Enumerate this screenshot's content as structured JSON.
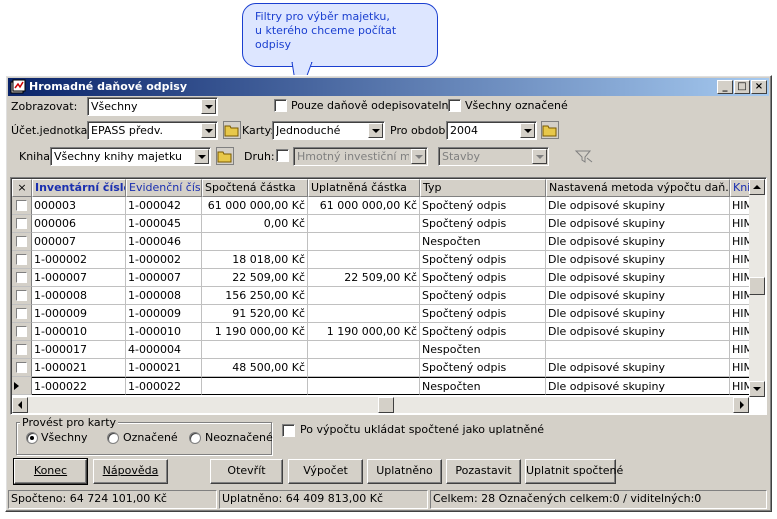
{
  "callout": {
    "text": "Filtry  pro výběr majetku,\nu kterého chceme počítat\nodpisy"
  },
  "window": {
    "title": "Hromadné daňové odpisy",
    "minimize": "_",
    "maximize": "□",
    "close": "×"
  },
  "filters": {
    "zobrazovat_label": "Zobrazovat:",
    "zobrazovat_value": "Všechny",
    "pouze_danove_label": "Pouze daňově odepisovatelné",
    "vsechny_oznacene_label": "Všechny označené",
    "ucet_jednotka_label": "Účet.jednotka:",
    "ucet_jednotka_value": "EPASS předv.",
    "karty_label": "Karty:",
    "karty_value": "Jednoduché",
    "pro_obdobi_label": "Pro období:",
    "pro_obdobi_value": "2004",
    "kniha_label": "Kniha:",
    "kniha_value": "Všechny knihy majetku",
    "druh_label": "Druh:",
    "druh_value": "Hmotný investiční majetek",
    "stavby_value": "Stavby"
  },
  "grid": {
    "columns": [
      "×",
      "Inventární číslo",
      "Evidenční číslo",
      "Spočtená částka",
      "Uplatněná částka",
      "Typ",
      "Nastavená metoda výpočtu daň. odp.",
      "Kniha"
    ],
    "rows": [
      {
        "checked": false,
        "inv": "000003",
        "evid": "1-000042",
        "spoctena": "61 000 000,00 Kč",
        "uplatnena": "61 000 000,00 Kč",
        "typ": "Spočtený odpis",
        "metoda": "Dle odpisové skupiny",
        "kniha": "HIM"
      },
      {
        "checked": false,
        "inv": "000006",
        "evid": "1-000045",
        "spoctena": "0,00 Kč",
        "uplatnena": "",
        "typ": "Spočtený odpis",
        "metoda": "Dle odpisové skupiny",
        "kniha": "HIM"
      },
      {
        "checked": false,
        "inv": "000007",
        "evid": "1-000046",
        "spoctena": "",
        "uplatnena": "",
        "typ": "Nespočten",
        "metoda": "Dle odpisové skupiny",
        "kniha": "HIM"
      },
      {
        "checked": false,
        "inv": "1-000002",
        "evid": "1-000002",
        "spoctena": "18 018,00 Kč",
        "uplatnena": "",
        "typ": "Spočtený odpis",
        "metoda": "Dle odpisové skupiny",
        "kniha": "HIM"
      },
      {
        "checked": false,
        "inv": "1-000007",
        "evid": "1-000007",
        "spoctena": "22 509,00 Kč",
        "uplatnena": "22 509,00 Kč",
        "typ": "Spočtený odpis",
        "metoda": "Dle odpisové skupiny",
        "kniha": "HIM"
      },
      {
        "checked": false,
        "inv": "1-000008",
        "evid": "1-000008",
        "spoctena": "156 250,00 Kč",
        "uplatnena": "",
        "typ": "Spočtený odpis",
        "metoda": "Dle odpisové skupiny",
        "kniha": "HIM"
      },
      {
        "checked": false,
        "inv": "1-000009",
        "evid": "1-000009",
        "spoctena": "91 520,00 Kč",
        "uplatnena": "",
        "typ": "Spočtený odpis",
        "metoda": "Dle odpisové skupiny",
        "kniha": "HIM"
      },
      {
        "checked": false,
        "inv": "1-000010",
        "evid": "1-000010",
        "spoctena": "1 190 000,00 Kč",
        "uplatnena": "1 190 000,00 Kč",
        "typ": "Spočtený odpis",
        "metoda": "Dle odpisové skupiny",
        "kniha": "HIM"
      },
      {
        "checked": false,
        "inv": "1-000017",
        "evid": "4-000004",
        "spoctena": "",
        "uplatnena": "",
        "typ": "Nespočten",
        "metoda": "",
        "kniha": "HIM"
      },
      {
        "checked": false,
        "inv": "1-000021",
        "evid": "1-000021",
        "spoctena": "48 500,00 Kč",
        "uplatnena": "",
        "typ": "Spočtený odpis",
        "metoda": "Dle odpisové skupiny",
        "kniha": "HIM"
      },
      {
        "checked": false,
        "inv": "1-000022",
        "evid": "1-000022",
        "spoctena": "",
        "uplatnena": "",
        "typ": "Nespočten",
        "metoda": "Dle odpisové skupiny",
        "kniha": "HIM",
        "current": true
      }
    ]
  },
  "options": {
    "group_title": "Provést pro karty",
    "radio_vsechny": "Všechny",
    "radio_oznacene": "Označené",
    "radio_neoznacene": "Neoznačené",
    "radio_selected": "vsechny",
    "save_as_applied_label": "Po výpočtu ukládat spočtené jako uplatněné"
  },
  "buttons": {
    "konec": "Konec",
    "napoveda": "Nápověda",
    "otevrit": "Otevřít",
    "vypocet": "Výpočet",
    "uplatneno": "Uplatněno",
    "pozastavit": "Pozastavit",
    "uplatnit_spoctene": "Uplatnit spočtené"
  },
  "status": {
    "spocteno": "Spočteno: 64 724 101,00 Kč",
    "uplatneno": "Uplatněno: 64 409 813,00 Kč",
    "celkem": "Celkem: 28  Označených celkem:0 / viditelných:0"
  }
}
